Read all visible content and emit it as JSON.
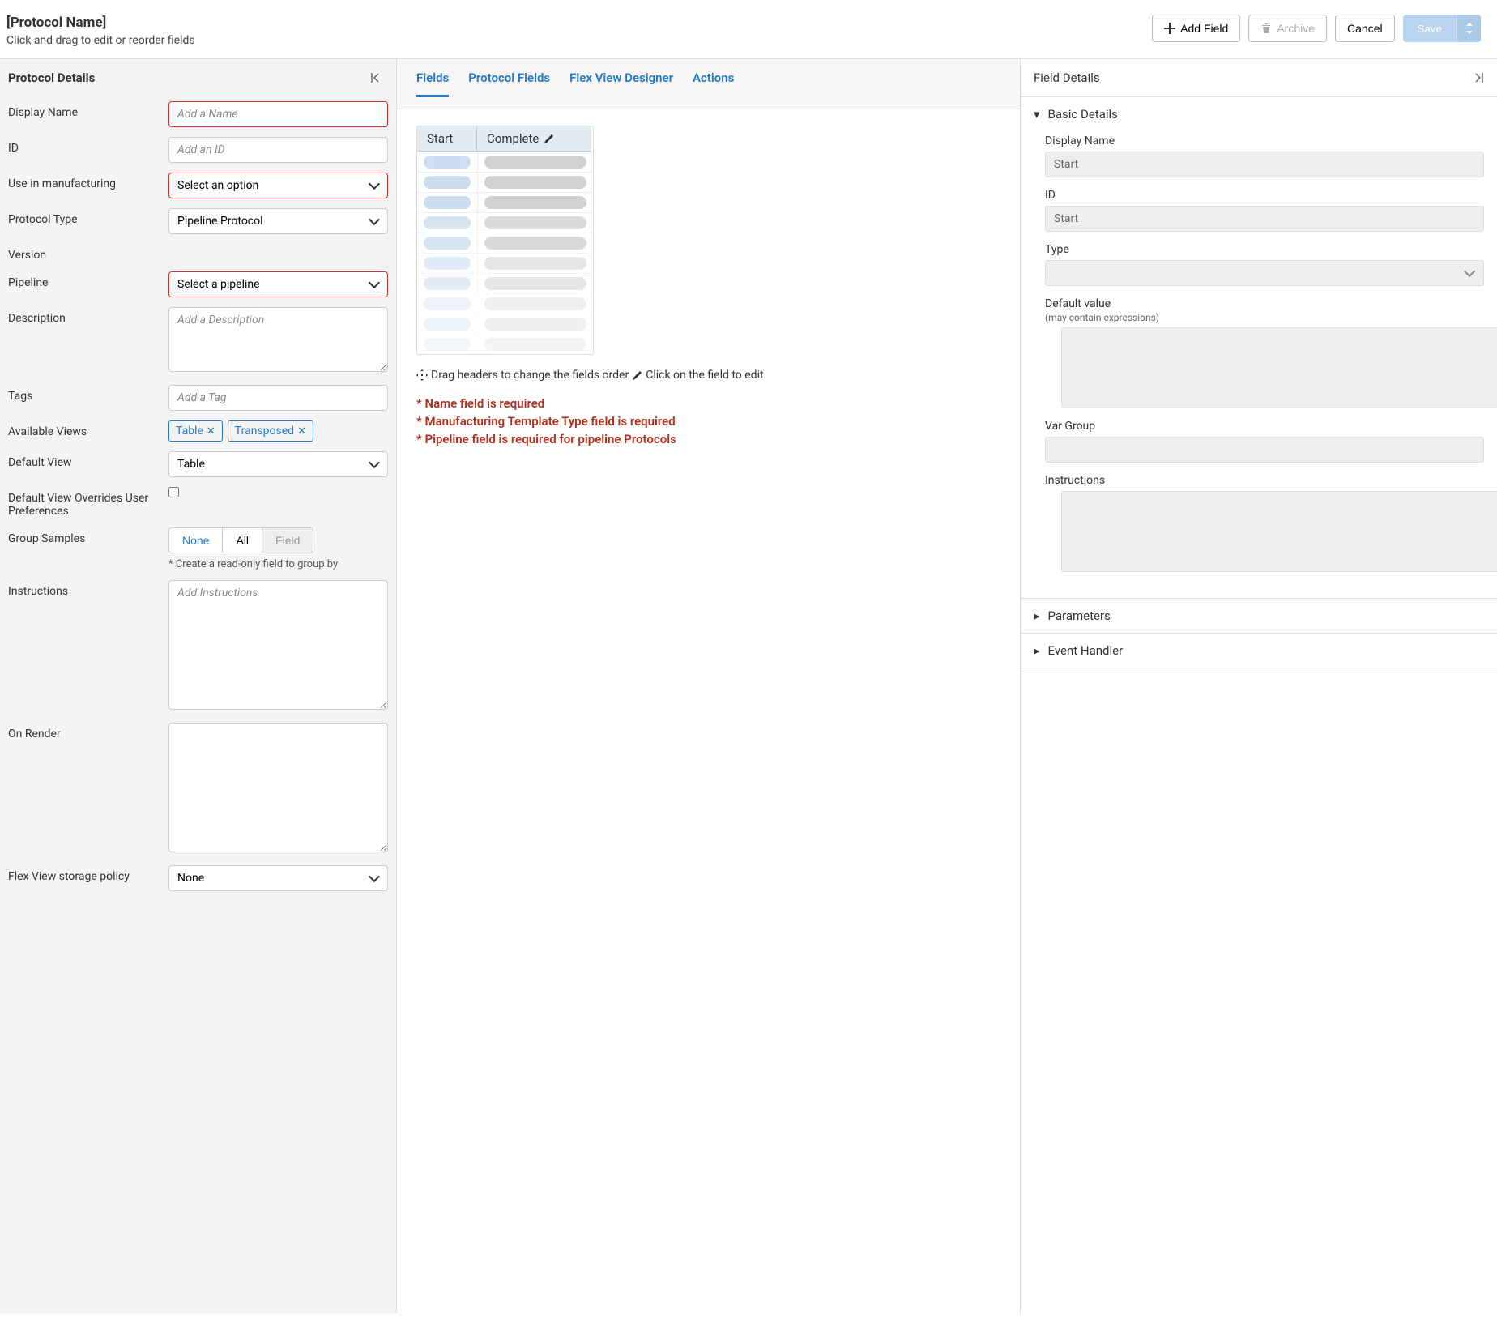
{
  "header": {
    "title": "[Protocol Name]",
    "subtitle": "Click and drag to edit or reorder fields",
    "add_field": "Add Field",
    "archive": "Archive",
    "cancel": "Cancel",
    "save": "Save"
  },
  "left": {
    "heading": "Protocol Details",
    "display_name_label": "Display Name",
    "display_name_ph": "Add a Name",
    "id_label": "ID",
    "id_ph": "Add an ID",
    "use_mfg_label": "Use in manufacturing",
    "use_mfg_value": "Select an option",
    "proto_type_label": "Protocol Type",
    "proto_type_value": "Pipeline Protocol",
    "version_label": "Version",
    "pipeline_label": "Pipeline",
    "pipeline_value": "Select a pipeline",
    "desc_label": "Description",
    "desc_ph": "Add a Description",
    "tags_label": "Tags",
    "tags_ph": "Add a Tag",
    "avail_views_label": "Available Views",
    "chip_table": "Table",
    "chip_transposed": "Transposed",
    "default_view_label": "Default View",
    "default_view_value": "Table",
    "override_label": "Default View Overrides User Preferences",
    "group_samples_label": "Group Samples",
    "seg_none": "None",
    "seg_all": "All",
    "seg_field": "Field",
    "group_hint": "* Create a read-only field to group by",
    "instructions_label": "Instructions",
    "instructions_ph": "Add Instructions",
    "onrender_label": "On Render",
    "flexview_label": "Flex View storage policy",
    "flexview_value": "None"
  },
  "mid": {
    "tabs": [
      "Fields",
      "Protocol Fields",
      "Flex View Designer",
      "Actions"
    ],
    "col_start": "Start",
    "col_complete": "Complete",
    "tip_drag": "Drag headers to change the fields order",
    "tip_click": "Click on the field to edit",
    "errors": [
      "* Name field is required",
      "* Manufacturing Template Type field is required",
      "* Pipeline field is required for pipeline Protocols"
    ]
  },
  "right": {
    "heading": "Field Details",
    "basic": "Basic Details",
    "display_name_label": "Display Name",
    "display_name_value": "Start",
    "id_label": "ID",
    "id_value": "Start",
    "type_label": "Type",
    "default_label": "Default value",
    "default_sub": "(may contain expressions)",
    "vargroup_label": "Var Group",
    "instructions_label": "Instructions",
    "parameters": "Parameters",
    "event_handler": "Event Handler"
  }
}
